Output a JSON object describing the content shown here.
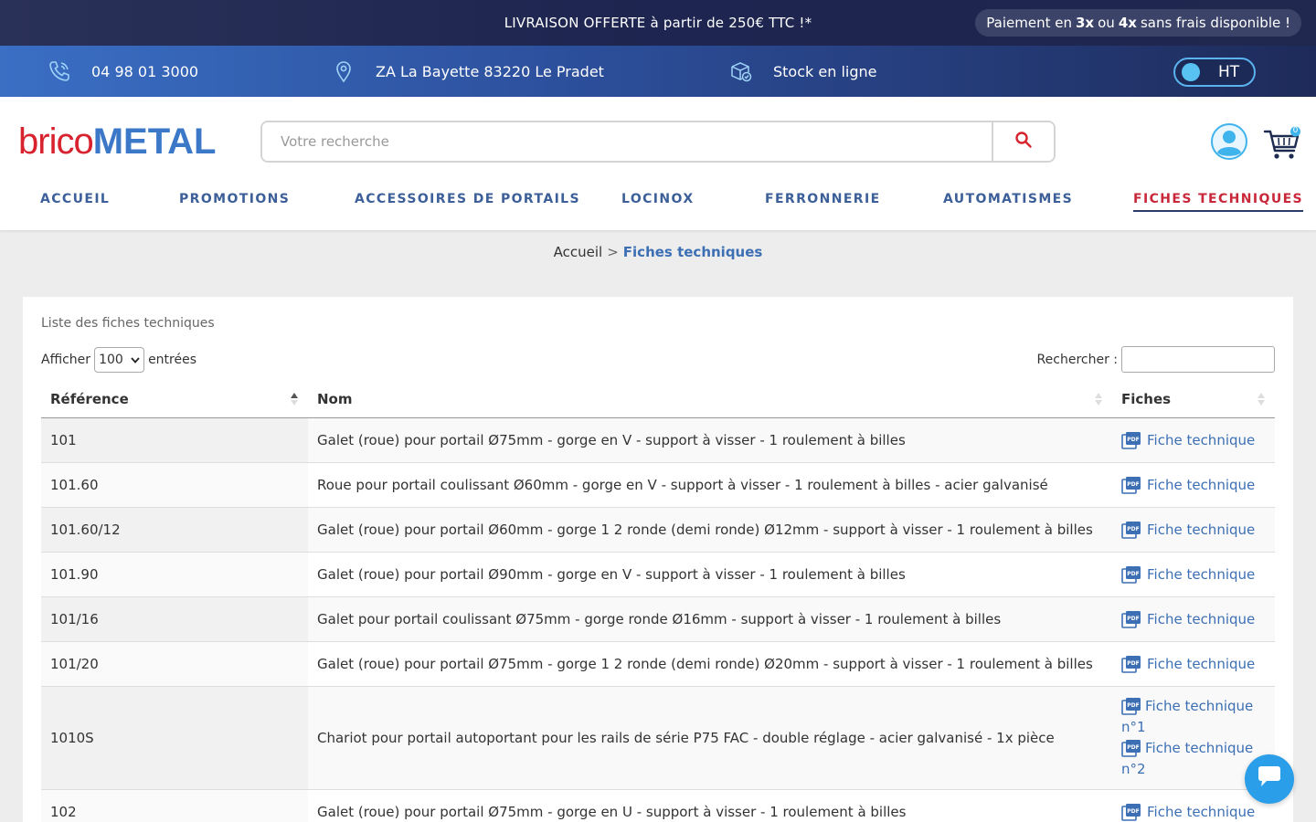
{
  "promo": {
    "text": "LIVRAISON OFFERTE à partir de 250€ TTC !*",
    "payment_prefix": "Paiement en",
    "payment_3x": "3x",
    "payment_or": "ou",
    "payment_4x": "4x",
    "payment_suffix": "sans frais disponible !"
  },
  "info": {
    "phone": "04 98 01 3000",
    "address": "ZA La Bayette 83220 Le Pradet",
    "stock": "Stock en ligne",
    "toggle_label": "HT"
  },
  "header": {
    "logo_brico": "brico",
    "logo_metal": "METAL",
    "search_placeholder": "Votre recherche",
    "cart_count": "0"
  },
  "nav": {
    "items": [
      {
        "label": "ACCUEIL"
      },
      {
        "label": "PROMOTIONS"
      },
      {
        "label": "ACCESSOIRES DE PORTAILS"
      },
      {
        "label": "LOCINOX"
      },
      {
        "label": "FERRONNERIE"
      },
      {
        "label": "AUTOMATISMES"
      },
      {
        "label": "FICHES TECHNIQUES"
      }
    ]
  },
  "breadcrumb": {
    "home": "Accueil",
    "separator": ">",
    "current": "Fiches techniques"
  },
  "content": {
    "title": "Liste des fiches techniques",
    "show_label": "Afficher",
    "show_value": "100",
    "entries_label": "entrées",
    "search_label": "Rechercher :",
    "columns": [
      "Référence",
      "Nom",
      "Fiches"
    ],
    "rows": [
      {
        "ref": "101",
        "nom": "Galet (roue) pour portail Ø75mm - gorge en V - support à visser - 1 roulement à billes",
        "fiche": "Fiche technique"
      },
      {
        "ref": "101.60",
        "nom": "Roue pour portail coulissant Ø60mm - gorge en V - support à visser - 1 roulement à billes - acier galvanisé",
        "fiche": "Fiche technique"
      },
      {
        "ref": "101.60/12",
        "nom": "Galet (roue) pour portail Ø60mm - gorge 1 2 ronde (demi ronde) Ø12mm - support à visser - 1 roulement à billes",
        "fiche": "Fiche technique"
      },
      {
        "ref": "101.90",
        "nom": "Galet (roue) pour portail Ø90mm - gorge en V - support à visser - 1 roulement à billes",
        "fiche": "Fiche technique"
      },
      {
        "ref": "101/16",
        "nom": "Galet pour portail coulissant Ø75mm - gorge ronde Ø16mm - support à visser - 1 roulement à billes",
        "fiche": "Fiche technique"
      },
      {
        "ref": "101/20",
        "nom": "Galet (roue) pour portail Ø75mm - gorge 1 2 ronde (demi ronde) Ø20mm - support à visser - 1 roulement à billes",
        "fiche": "Fiche technique"
      },
      {
        "ref": "1010S",
        "nom": "Chariot pour portail autoportant pour les rails de série P75 FAC - double réglage - acier galvanisé - 1x pièce",
        "fiche1": "Fiche technique",
        "fiche1_suffix": "n°1",
        "fiche2": "Fiche technique",
        "fiche2_suffix": "n°2"
      },
      {
        "ref": "102",
        "nom": "Galet (roue) pour portail Ø75mm - gorge en U - support à visser - 1 roulement à billes",
        "fiche": "Fiche technique"
      }
    ]
  },
  "colors": {
    "accent_blue": "#3c6fb4",
    "brand_red": "#d8232f",
    "navy": "#1d2550",
    "chat_blue": "#2a9ee8"
  },
  "icons": [
    "phone-icon",
    "location-pin-icon",
    "stock-box-icon",
    "search-icon",
    "account-icon",
    "cart-icon",
    "pdf-icon",
    "sort-icon",
    "chat-icon"
  ]
}
